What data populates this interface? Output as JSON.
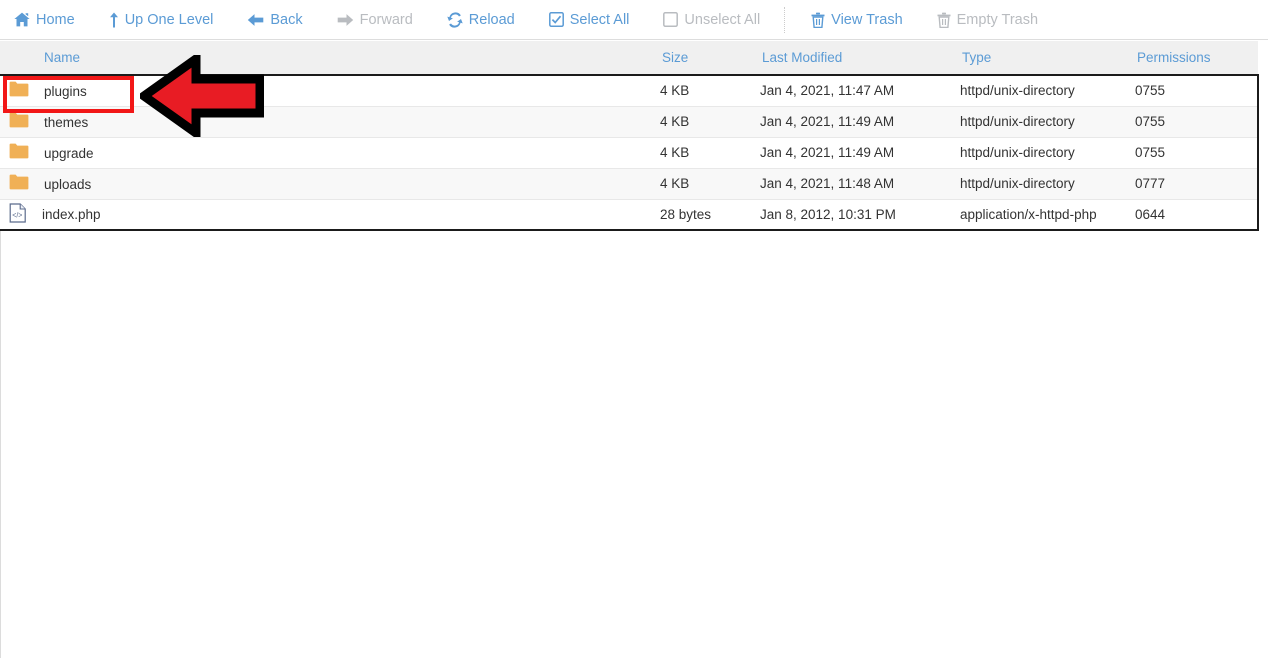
{
  "toolbar": {
    "items": [
      {
        "label": "Home",
        "icon": "home-icon",
        "state": "enabled"
      },
      {
        "label": "Up One Level",
        "icon": "arrow-up-icon",
        "state": "enabled"
      },
      {
        "label": "Back",
        "icon": "arrow-left-icon",
        "state": "enabled"
      },
      {
        "label": "Forward",
        "icon": "arrow-right-icon",
        "state": "disabled"
      },
      {
        "label": "Reload",
        "icon": "reload-icon",
        "state": "enabled"
      },
      {
        "label": "Select All",
        "icon": "checkbox-checked-icon",
        "state": "enabled"
      },
      {
        "label": "Unselect All",
        "icon": "checkbox-empty-icon",
        "state": "disabled"
      },
      {
        "label": "View Trash",
        "icon": "trash-icon",
        "state": "enabled"
      },
      {
        "label": "Empty Trash",
        "icon": "trash-icon",
        "state": "disabled"
      }
    ]
  },
  "table": {
    "columns": [
      "Name",
      "Size",
      "Last Modified",
      "Type",
      "Permissions"
    ],
    "rows": [
      {
        "icon": "folder-icon",
        "name": "plugins",
        "size": "4 KB",
        "modified": "Jan 4, 2021, 11:47 AM",
        "type": "httpd/unix-directory",
        "permissions": "0755"
      },
      {
        "icon": "folder-icon",
        "name": "themes",
        "size": "4 KB",
        "modified": "Jan 4, 2021, 11:49 AM",
        "type": "httpd/unix-directory",
        "permissions": "0755"
      },
      {
        "icon": "folder-icon",
        "name": "upgrade",
        "size": "4 KB",
        "modified": "Jan 4, 2021, 11:49 AM",
        "type": "httpd/unix-directory",
        "permissions": "0755"
      },
      {
        "icon": "folder-icon",
        "name": "uploads",
        "size": "4 KB",
        "modified": "Jan 4, 2021, 11:48 AM",
        "type": "httpd/unix-directory",
        "permissions": "0777"
      },
      {
        "icon": "php-file-icon",
        "name": "index.php",
        "size": "28 bytes",
        "modified": "Jan 8, 2012, 10:31 PM",
        "type": "application/x-httpd-php",
        "permissions": "0644"
      }
    ]
  },
  "annotations": {
    "highlight_box": {
      "target": "plugins",
      "color": "#f21717"
    },
    "pointer_arrow": {
      "direction": "left",
      "target": "plugins",
      "fill": "#e81c24",
      "stroke": "#000000"
    }
  },
  "colors": {
    "link_blue": "#5b9bd5",
    "disabled_gray": "#b9bcc0",
    "folder_orange": "#f0b056",
    "header_bg": "#f0f0f0",
    "row_alt_bg": "#f8f8f8",
    "text": "#333333"
  }
}
